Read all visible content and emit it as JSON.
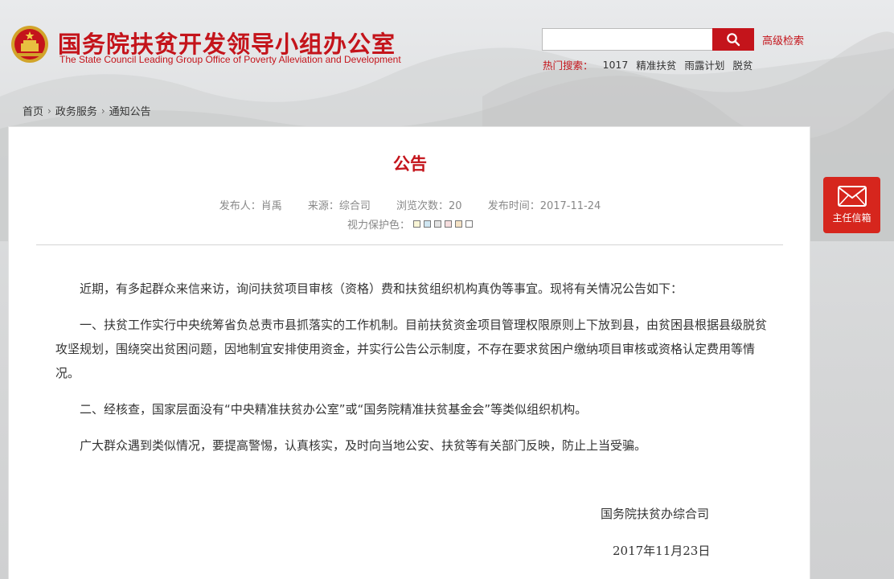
{
  "header": {
    "title": "国务院扶贫开发领导小组办公室",
    "subtitle": "The State Council Leading Group Office of Poverty Alleviation and Development",
    "search_placeholder": "",
    "advanced_search": "高级检索",
    "hot_label": "热门搜索：",
    "hot_items": [
      "1017",
      "精准扶贫",
      "雨露计划",
      "脱贫"
    ]
  },
  "breadcrumb": [
    "首页",
    "政务服务",
    "通知公告"
  ],
  "article": {
    "title": "公告",
    "publisher": "发布人：肖禹",
    "source": "来源：综合司",
    "views": "浏览次数：20",
    "published": "发布时间：2017-11-24",
    "eye_care_label": "视力保护色：",
    "eye_care_colors": [
      "#faf6d6",
      "#cfe6f2",
      "#e3e3e3",
      "#f6ddde",
      "#f5e2c5",
      "#ffffff"
    ],
    "paragraphs": [
      "近期，有多起群众来信来访，询问扶贫项目审核（资格）费和扶贫组织机构真伪等事宜。现将有关情况公告如下：",
      "一、扶贫工作实行中央统筹省负总责市县抓落实的工作机制。目前扶贫资金项目管理权限原则上下放到县，由贫困县根据县级脱贫攻坚规划，围绕突出贫困问题，因地制宜安排使用资金，并实行公告公示制度，不存在要求贫困户缴纳项目审核或资格认定费用等情况。",
      "二、经核查，国家层面没有“中央精准扶贫办公室”或“国务院精准扶贫基金会”等类似组织机构。",
      "广大群众遇到类似情况，要提高警惕，认真核实，及时向当地公安、扶贫等有关部门反映，防止上当受骗。"
    ],
    "signoff": "国务院扶贫办综合司",
    "date": "2017年11月23日"
  },
  "mailbox": {
    "label": "主任信箱"
  },
  "colors": {
    "brand_red": "#c4141b",
    "mailbox_red": "#d6261d"
  }
}
